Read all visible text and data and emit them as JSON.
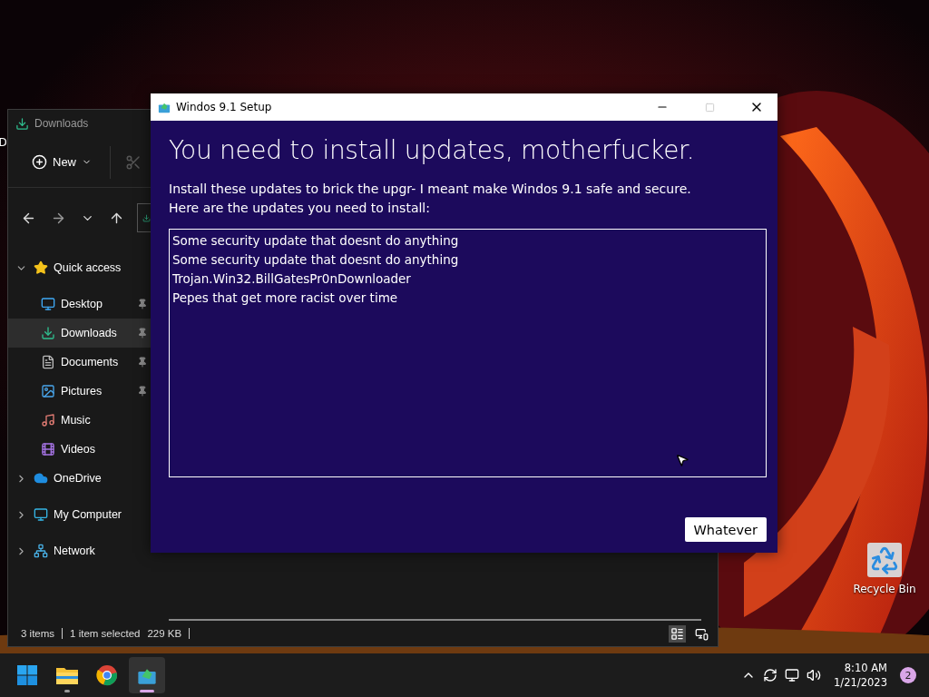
{
  "desktop_icons": [
    {
      "label": "D"
    },
    {
      "label": "Recycle Bin"
    }
  ],
  "explorer": {
    "title": "Downloads",
    "new_label": "New",
    "nav": [
      {
        "label": "Quick access",
        "kind": "star",
        "expanded": true,
        "selected": false,
        "children": [
          {
            "label": "Desktop",
            "kind": "desktop",
            "pinned": true,
            "selected": false
          },
          {
            "label": "Downloads",
            "kind": "download",
            "pinned": true,
            "selected": true
          },
          {
            "label": "Documents",
            "kind": "documents",
            "pinned": true,
            "selected": false
          },
          {
            "label": "Pictures",
            "kind": "pictures",
            "pinned": true,
            "selected": false
          },
          {
            "label": "Music",
            "kind": "music",
            "pinned": false,
            "selected": false
          },
          {
            "label": "Videos",
            "kind": "videos",
            "pinned": false,
            "selected": false
          }
        ]
      },
      {
        "label": "OneDrive",
        "kind": "cloud",
        "expanded": false,
        "selected": false
      },
      {
        "label": "My Computer",
        "kind": "computer",
        "expanded": false,
        "selected": false
      },
      {
        "label": "Network",
        "kind": "network",
        "expanded": false,
        "selected": false
      }
    ],
    "status": [
      "3 items",
      "1 item selected",
      "229 KB"
    ],
    "views": [
      {
        "kind": "details",
        "selected": true
      },
      {
        "kind": "tiles",
        "selected": false
      }
    ]
  },
  "setup": {
    "title": "Windos 9.1 Setup",
    "controls": [
      {
        "kind": "minimize",
        "disabled": false
      },
      {
        "kind": "maximize",
        "disabled": true
      },
      {
        "kind": "close",
        "disabled": false
      }
    ],
    "heading": "You need to install updates, motherfucker.",
    "description": [
      "Install these updates to brick the upgr- I meant make Windos 9.1 safe and secure.",
      "Here are the updates you need to install:"
    ],
    "updates": [
      "Some security update that doesnt do anything",
      "Some security update that doesnt do anything",
      "Trojan.Win32.BillGatesPr0nDownloader",
      "Pepes that get more racist over time"
    ],
    "button": "Whatever"
  },
  "taskbar": {
    "apps": [
      {
        "kind": "start",
        "running": false,
        "active": false
      },
      {
        "kind": "folder",
        "running": true,
        "active": false
      },
      {
        "kind": "browser",
        "running": false,
        "active": false
      },
      {
        "kind": "setup",
        "running": true,
        "active": true
      }
    ],
    "time": "8:10 AM",
    "date": "1/21/2023",
    "notifications": "2"
  }
}
